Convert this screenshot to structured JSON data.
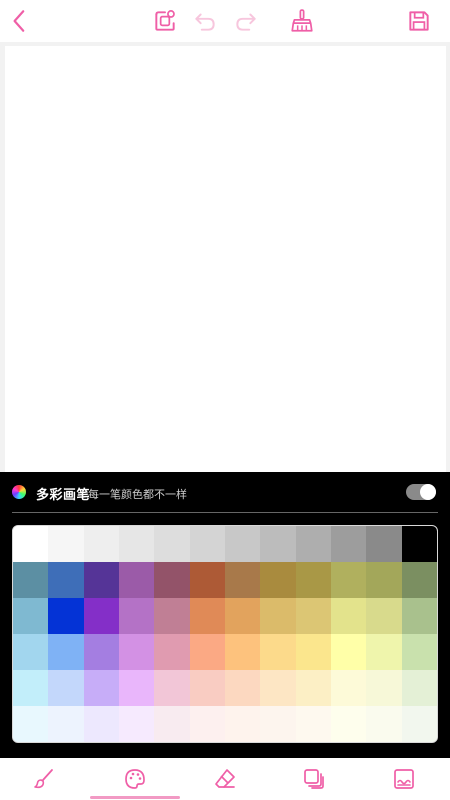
{
  "accent": "#ef5fa7",
  "toolbar": {
    "icons": [
      "back-icon",
      "add-image-icon",
      "undo-icon",
      "redo-icon",
      "clear-broom-icon",
      "save-icon"
    ]
  },
  "multicolor": {
    "title": "多彩画笔",
    "description": "每一笔颜色都不一样",
    "enabled": true
  },
  "palette": {
    "rows": [
      [
        "#ffffff",
        "#f6f6f6",
        "#eeeeee",
        "#e6e6e6",
        "#dddddd",
        "#d4d4d4",
        "#c8c8c8",
        "#bcbcbc",
        "#aeaeae",
        "#9d9d9d",
        "#8a8a8a",
        "#000000"
      ],
      [
        "#5c8fa3",
        "#3e6eb8",
        "#553497",
        "#9b5ba8",
        "#935369",
        "#ad5a36",
        "#a8794a",
        "#a98b3e",
        "#a99846",
        "#b0b05e",
        "#a3a75a",
        "#7b8f61"
      ],
      [
        "#7fb9d1",
        "#0433d6",
        "#842fc8",
        "#b472c6",
        "#c07f95",
        "#e08a57",
        "#e2a35d",
        "#dbbb6a",
        "#dcc674",
        "#e3e38c",
        "#d8da8c",
        "#a9c18d"
      ],
      [
        "#a2d6ee",
        "#7fb2f5",
        "#a47ee1",
        "#d391e4",
        "#e09bb0",
        "#fba984",
        "#fdc27d",
        "#fcda8b",
        "#fbe68d",
        "#ffffa8",
        "#eff5ac",
        "#c9e1ad"
      ],
      [
        "#c2eefa",
        "#c3d7fb",
        "#c7adf8",
        "#e9b6fb",
        "#f2c6d7",
        "#f9ccc2",
        "#fcd8c0",
        "#fde6c4",
        "#fcefc5",
        "#fdfad8",
        "#f7f8d8",
        "#e4f0d6"
      ],
      [
        "#e8f8fe",
        "#edf3fe",
        "#ede8fe",
        "#f6eafe",
        "#f8ebf0",
        "#fdf0ef",
        "#fef3ed",
        "#fdf5ee",
        "#fef9ef",
        "#fefeed",
        "#fafbee",
        "#f2f7ee"
      ]
    ]
  },
  "bottom_nav": {
    "icons": [
      "brush-icon",
      "palette-icon",
      "eraser-icon",
      "layers-icon",
      "background-image-icon"
    ],
    "active_index": 1
  }
}
